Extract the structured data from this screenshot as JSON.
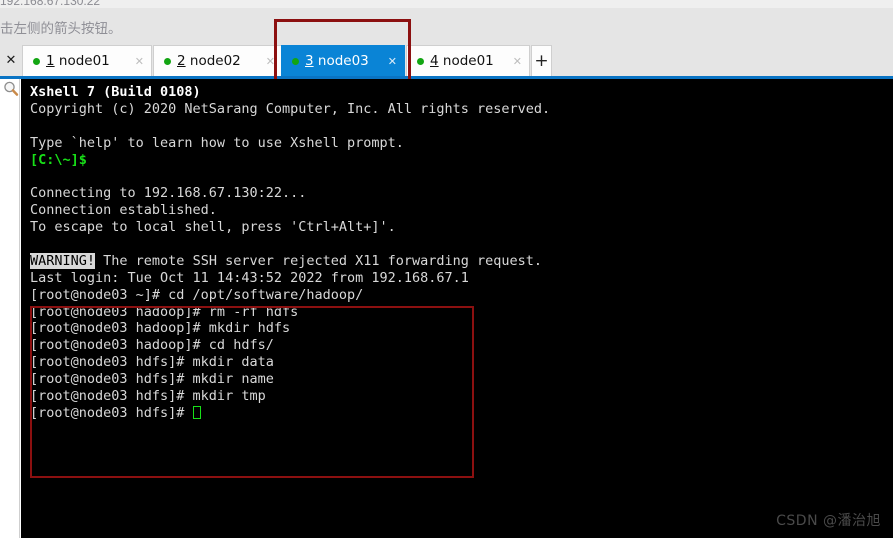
{
  "window": {
    "top_hint_text": "击左侧的箭头按钮。",
    "clipped_line_text": "192.168.67.130:22"
  },
  "tab_bar": {
    "close_all_label": "✕",
    "new_tab_label": "+",
    "close_glyph": "✕",
    "active_tab_index": 2,
    "tabs": [
      {
        "mnemonic": "1",
        "name": "node01",
        "status": "connected",
        "active": false
      },
      {
        "mnemonic": "2",
        "name": "node02",
        "status": "connected",
        "active": false
      },
      {
        "mnemonic": "3",
        "name": "node03",
        "status": "connected",
        "active": true
      },
      {
        "mnemonic": "4",
        "name": "node01",
        "status": "connected",
        "active": false
      }
    ]
  },
  "sidebar": {
    "search_icon": "search-icon"
  },
  "terminal": {
    "lines": [
      {
        "segments": [
          {
            "text": "Xshell 7 (Build 0108)",
            "style": "bold"
          }
        ]
      },
      {
        "segments": [
          {
            "text": "Copyright (c) 2020 NetSarang Computer, Inc. All rights reserved.",
            "style": "white"
          }
        ]
      },
      {
        "segments": [
          {
            "text": "",
            "style": "white"
          }
        ]
      },
      {
        "segments": [
          {
            "text": "Type `help' to learn how to use Xshell prompt.",
            "style": "white"
          }
        ]
      },
      {
        "segments": [
          {
            "text": "[C:\\~]$",
            "style": "green"
          }
        ]
      },
      {
        "segments": [
          {
            "text": "",
            "style": "white"
          }
        ]
      },
      {
        "segments": [
          {
            "text": "Connecting to 192.168.67.130:22...",
            "style": "white"
          }
        ]
      },
      {
        "segments": [
          {
            "text": "Connection established.",
            "style": "white"
          }
        ]
      },
      {
        "segments": [
          {
            "text": "To escape to local shell, press 'Ctrl+Alt+]'.",
            "style": "white"
          }
        ]
      },
      {
        "segments": [
          {
            "text": "",
            "style": "white"
          }
        ]
      },
      {
        "segments": [
          {
            "text": "WARNING!",
            "style": "inverse"
          },
          {
            "text": " The remote SSH server rejected X11 forwarding request.",
            "style": "white"
          }
        ]
      },
      {
        "segments": [
          {
            "text": "Last login: Tue Oct 11 14:43:52 2022 from 192.168.67.1",
            "style": "white"
          }
        ]
      },
      {
        "segments": [
          {
            "text": "[root@node03 ~]# cd /opt/software/hadoop/",
            "style": "white"
          }
        ]
      },
      {
        "segments": [
          {
            "text": "[root@node03 hadoop]# rm -rf hdfs",
            "style": "white"
          }
        ]
      },
      {
        "segments": [
          {
            "text": "[root@node03 hadoop]# mkdir hdfs",
            "style": "white"
          }
        ]
      },
      {
        "segments": [
          {
            "text": "[root@node03 hadoop]# cd hdfs/",
            "style": "white"
          }
        ]
      },
      {
        "segments": [
          {
            "text": "[root@node03 hdfs]# mkdir data",
            "style": "white"
          }
        ]
      },
      {
        "segments": [
          {
            "text": "[root@node03 hdfs]# mkdir name",
            "style": "white"
          }
        ]
      },
      {
        "segments": [
          {
            "text": "[root@node03 hdfs]# mkdir tmp",
            "style": "white"
          }
        ]
      },
      {
        "segments": [
          {
            "text": "[root@node03 hdfs]# ",
            "style": "white"
          },
          {
            "text": "",
            "style": "cursor"
          }
        ]
      }
    ]
  },
  "annotations": {
    "color": "#8c1010",
    "tab_highlight_label": "active-tab-highlight",
    "command-block_label": "command-block-highlight"
  },
  "watermark": {
    "text": "CSDN @潘治旭"
  }
}
